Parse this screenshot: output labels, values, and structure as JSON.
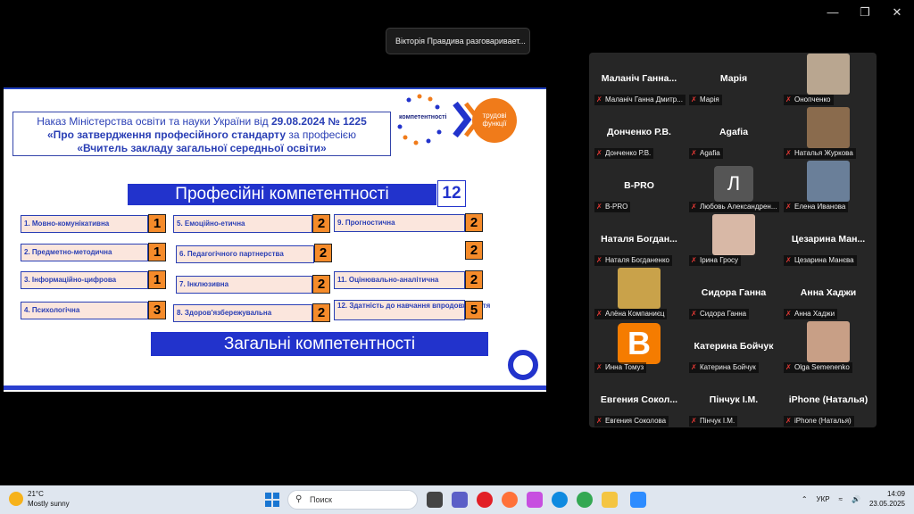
{
  "window": {
    "minimize": "—",
    "restore": "❐",
    "close": "✕"
  },
  "toast": "Вікторія Правдива разговаривает...",
  "slide": {
    "order_line1_a": "Наказ Міністерства освіти та науки  України від ",
    "order_date": "29.08.2024",
    "order_num": "  №  1225",
    "order_line2_a": "«Про затвердження професійного стандарту",
    "order_line2_b": " за професією",
    "order_line3": "«Вчитель закладу загальної середньої освіти»",
    "logo_text": "компетентності",
    "logo_circle": "трудові функції",
    "prof_banner": "Професійні компетентності",
    "prof_count": "12",
    "general_banner": "Загальні компетентності",
    "competencies": [
      {
        "label": "1. Мовно-комунікативна",
        "value": "1"
      },
      {
        "label": "2. Предметно-методична",
        "value": "1"
      },
      {
        "label": "3. Інформаційно-цифрова",
        "value": "1"
      },
      {
        "label": "4. Психологічна",
        "value": "3"
      },
      {
        "label": "5. Емоційно-етична",
        "value": "2"
      },
      {
        "label": "6. Педагогічного партнерства",
        "value": "2"
      },
      {
        "label": "7. Інклюзивна",
        "value": "2"
      },
      {
        "label": "8. Здоров'язбережувальна",
        "value": "2"
      },
      {
        "label": "9. Прогностична",
        "value": "2"
      },
      {
        "label": "",
        "value": "2"
      },
      {
        "label": "11. Оцінювально-аналітична",
        "value": "2"
      },
      {
        "label": "12. Здатність до навчання впродовж життя",
        "value": "5"
      }
    ]
  },
  "participants": [
    {
      "big": "Маланіч Ганна...",
      "name": "Маланіч Ганна Дмитр..."
    },
    {
      "big": "Марія",
      "name": "Марія"
    },
    {
      "big": "",
      "name": "Онопченко"
    },
    {
      "big": "Донченко Р.В.",
      "name": "Донченко Р.В."
    },
    {
      "big": "Agafia",
      "name": "Agafia"
    },
    {
      "big": "",
      "name": "Наталья Журкова"
    },
    {
      "big": "B-PRO",
      "name": "B-PRO"
    },
    {
      "big": "Л",
      "name": "Любовь Александрен..."
    },
    {
      "big": "",
      "name": "Елена Иванова"
    },
    {
      "big": "Наталя Богдан...",
      "name": "Наталя Богданенко"
    },
    {
      "big": "",
      "name": "Ірина Гросу"
    },
    {
      "big": "Цезарина Ман...",
      "name": "Цезарина Манєва"
    },
    {
      "big": "",
      "name": "Алёна Компаниєц"
    },
    {
      "big": "Сидора Ганна",
      "name": "Сидора Ганна"
    },
    {
      "big": "Анна Хаджи",
      "name": "Анна Хаджи"
    },
    {
      "big": "B",
      "name": "Инна Томуз"
    },
    {
      "big": "Катерина Бойчук",
      "name": "Катерина Бойчук"
    },
    {
      "big": "",
      "name": "Olga Semenenko"
    },
    {
      "big": "Евгения Сокол...",
      "name": "Евгения Соколова"
    },
    {
      "big": "Пінчук І.М.",
      "name": "Пінчук І.М."
    },
    {
      "big": "iPhone (Наталья)",
      "name": "iPhone (Наталья)"
    }
  ],
  "taskbar": {
    "temp": "21°C",
    "weather": "Mostly sunny",
    "search_placeholder": "Поиск",
    "lang": "УКР",
    "time": "14:09",
    "date": "23.05.2025"
  },
  "colors": {
    "accent": "#2233cc",
    "badge": "#f58b2a",
    "panel": "#262626"
  }
}
